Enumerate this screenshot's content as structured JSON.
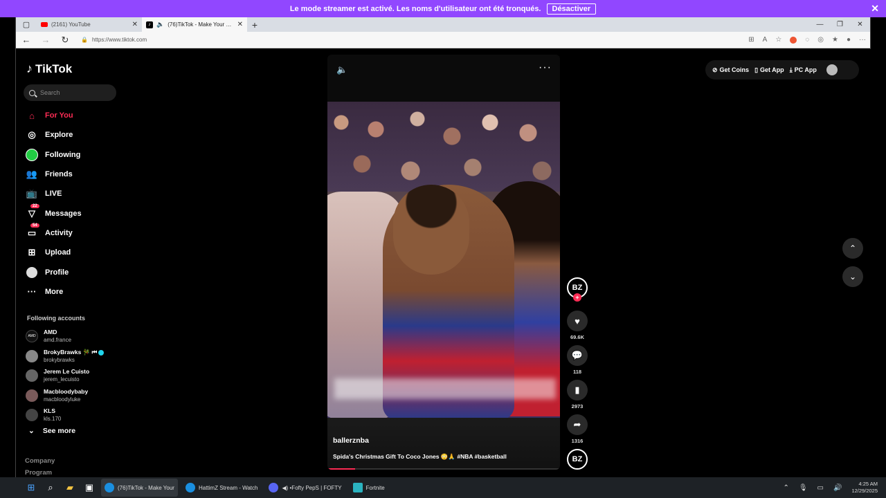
{
  "banner": {
    "message": "Le mode streamer est activé. Les noms d'utilisateur ont été tronqués.",
    "button": "Désactiver",
    "close": "✕"
  },
  "browser": {
    "tabs": [
      {
        "title": "(2161) YouTube",
        "active": false
      },
      {
        "title": "(76)TikTok - Make Your Day",
        "active": true
      }
    ],
    "url": "https://www.tiktok.com"
  },
  "tiktok": {
    "logo": "TikTok",
    "search_placeholder": "Search",
    "menu": [
      {
        "label": "For You",
        "icon": "home-icon"
      },
      {
        "label": "Explore",
        "icon": "compass-icon"
      },
      {
        "label": "Following",
        "icon": "following-avatar-icon"
      },
      {
        "label": "Friends",
        "icon": "friends-icon"
      },
      {
        "label": "LIVE",
        "icon": "live-icon"
      },
      {
        "label": "Messages",
        "icon": "messages-icon",
        "badge": "22"
      },
      {
        "label": "Activity",
        "icon": "activity-icon",
        "badge": "54"
      },
      {
        "label": "Upload",
        "icon": "upload-icon"
      },
      {
        "label": "Profile",
        "icon": "profile-avatar-icon"
      },
      {
        "label": "More",
        "icon": "more-icon"
      }
    ],
    "following_heading": "Following accounts",
    "accounts": [
      {
        "name": "AMD",
        "username": "amd.france",
        "avatar": "AMD"
      },
      {
        "name": "BrokyBrawks 🎋 ⏮",
        "username": "brokybrawks",
        "verified": true
      },
      {
        "name": "Jerem Le Cuisto",
        "username": "jerem_lecuisto"
      },
      {
        "name": "Macbloodybaby",
        "username": "macbloodyluke"
      },
      {
        "name": "KLS",
        "username": "kls.170"
      }
    ],
    "see_more": "See more",
    "footer": [
      "Company",
      "Program"
    ],
    "top_right": {
      "get_coins": "Get Coins",
      "get_app": "Get App",
      "pc_app": "PC App"
    },
    "video": {
      "author": "ballerznba",
      "caption": "Spida's Christmas Gift To Coco Jones 😳🙏 #NBA #basketball",
      "progress": 0.12,
      "creator_initials": "BZ",
      "likes": "69.6K",
      "comments": "118",
      "saves": "2973",
      "shares": "1316"
    }
  },
  "taskbar": {
    "items": [
      {
        "label": "(76)TikTok - Make Your",
        "active": true,
        "color": "#1a8fe0"
      },
      {
        "label": "HattimZ Stream - Watch",
        "active": false,
        "color": "#1a8fe0"
      },
      {
        "label": "◀) •Fofty PepS | FOFTY",
        "active": false,
        "color": "#5865f2"
      },
      {
        "label": "Fortnite",
        "active": false,
        "color": "#2bb3c0"
      }
    ],
    "time": "4:25 AM",
    "date": "12/29/2025"
  }
}
